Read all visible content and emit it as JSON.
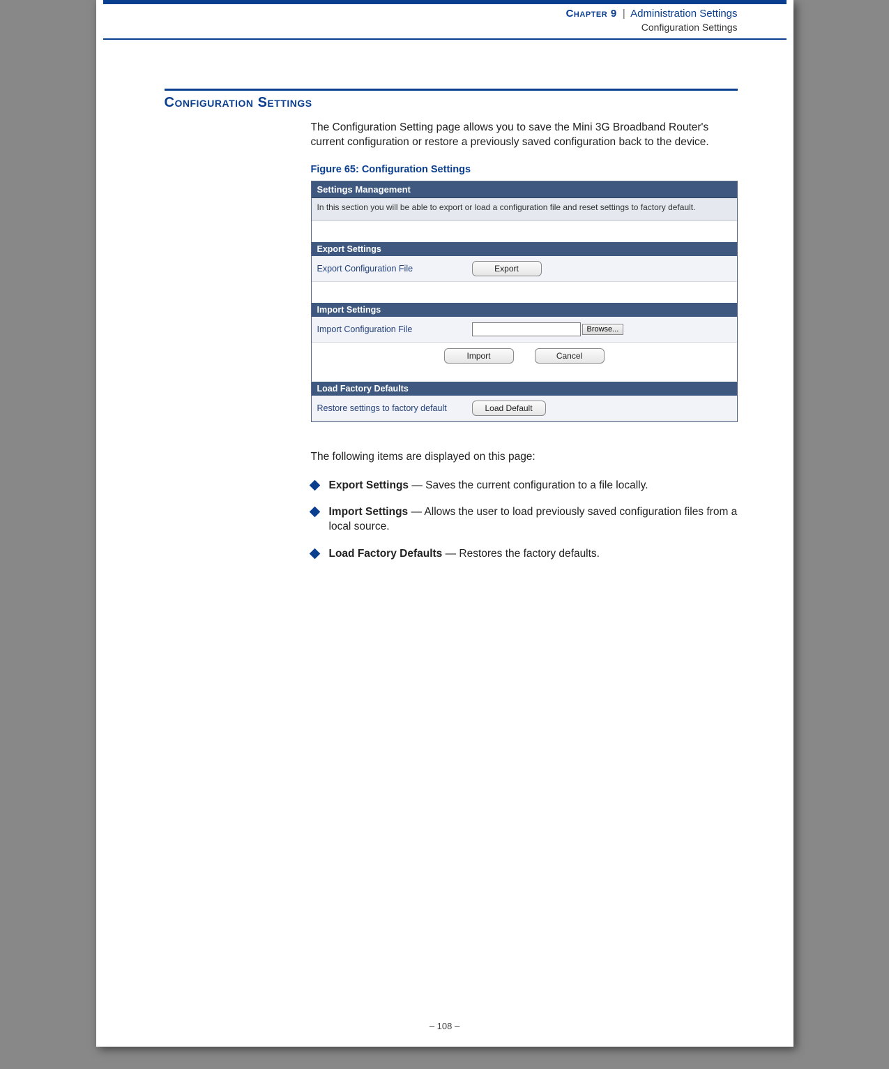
{
  "header": {
    "chapter_label": "Chapter 9",
    "separator": "|",
    "section_title": "Administration Settings",
    "subsection": "Configuration Settings"
  },
  "section_heading": "Configuration Settings",
  "intro_paragraph": "The Configuration Setting page allows you to save the Mini 3G Broadband Router's current configuration or restore a previously saved configuration back to the device.",
  "figure_caption": "Figure 65:  Configuration Settings",
  "ui": {
    "panel_title": "Settings Management",
    "panel_desc": "In this section you will be able to export or load a configuration file and reset settings to factory default.",
    "export_header": "Export Settings",
    "export_label": "Export Configuration File",
    "export_button": "Export",
    "import_header": "Import Settings",
    "import_label": "Import Configuration File",
    "browse_button": "Browse...",
    "import_button": "Import",
    "cancel_button": "Cancel",
    "defaults_header": "Load Factory Defaults",
    "defaults_label": "Restore settings to factory default",
    "defaults_button": "Load Default"
  },
  "items_intro": "The following items are displayed on this page:",
  "bullets": [
    {
      "title": "Export Settings",
      "desc": " — Saves the current configuration to a file locally."
    },
    {
      "title": "Import Settings",
      "desc": " — Allows the user to load previously saved configuration files from a local source."
    },
    {
      "title": "Load Factory Defaults",
      "desc": " — Restores the factory defaults."
    }
  ],
  "footer": {
    "page_number": "–  108  –"
  }
}
